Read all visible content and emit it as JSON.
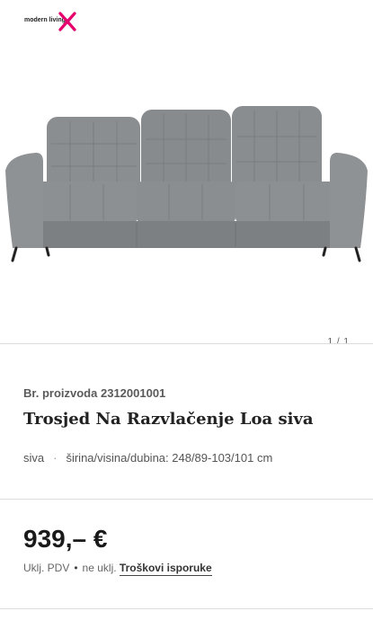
{
  "brand": {
    "logo_text": "modern living",
    "accent": "#e5006d"
  },
  "gallery": {
    "pager": "1 / 1",
    "image_alt": "Trosjed Na Razvlačenje Loa siva"
  },
  "product": {
    "number_label": "Br. proizvoda",
    "number": "2312001001",
    "title_strong": "Trosjed",
    "title_rest": " Na Razvlačenje Loa siva",
    "color": "siva",
    "dimensions": "širina/visina/dubina: 248/89-103/101 cm"
  },
  "pricing": {
    "price": "939,– €",
    "tax_label": "Uklj. PDV",
    "shipping_prefix": "ne uklj.",
    "shipping_link": "Troškovi isporuke"
  },
  "colors": {
    "divider": "#dcdcdc",
    "sofa": "#8a8d90",
    "sofa_dark": "#6f7275"
  }
}
